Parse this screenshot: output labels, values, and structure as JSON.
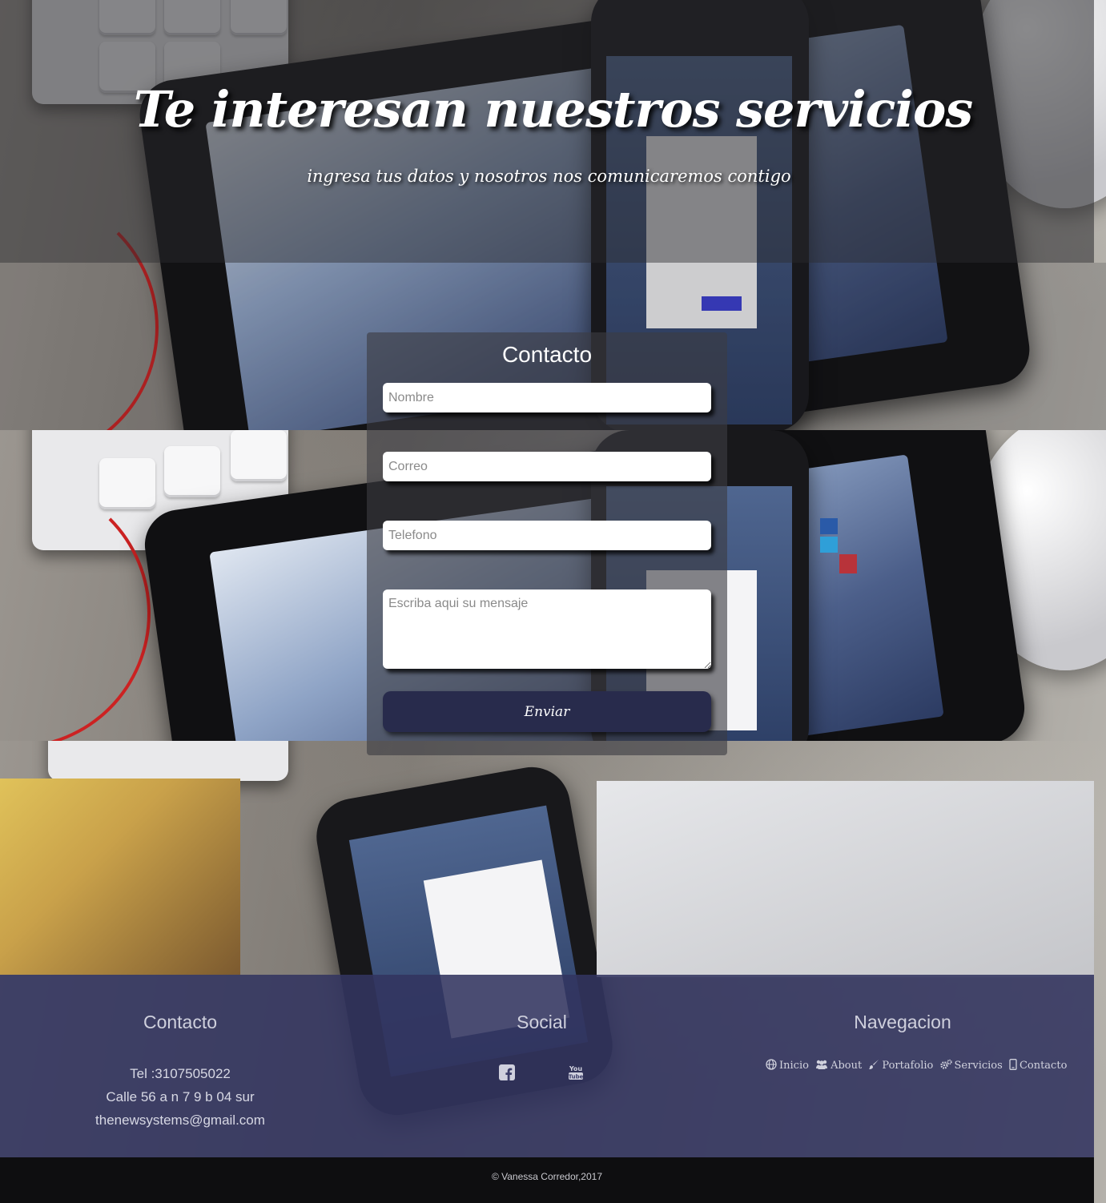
{
  "header": {
    "title": "Te interesan nuestros servicios",
    "subtitle": "ingresa tus datos y nosotros nos comunicaremos contigo"
  },
  "contact_form": {
    "title": "Contacto",
    "name_placeholder": "Nombre",
    "email_placeholder": "Correo",
    "phone_placeholder": "Telefono",
    "message_placeholder": "Escriba aqui su mensaje",
    "submit_label": "Enviar"
  },
  "footer": {
    "contact": {
      "heading": "Contacto",
      "phone": "Tel :3107505022",
      "address": "Calle 56 a n 7 9 b 04 sur",
      "email": "thenewsystems@gmail.com"
    },
    "social": {
      "heading": "Social",
      "icons": [
        "facebook-icon",
        "youtube-icon"
      ]
    },
    "navigation": {
      "heading": "Navegacion",
      "items": [
        {
          "label": "Inicio",
          "icon": "globe-icon"
        },
        {
          "label": "About",
          "icon": "users-icon"
        },
        {
          "label": "Portafolio",
          "icon": "brush-icon"
        },
        {
          "label": "Servicios",
          "icon": "gears-icon"
        },
        {
          "label": "Contacto",
          "icon": "mobile-icon"
        }
      ]
    },
    "copyright": "© Vanessa Corredor,2017"
  },
  "colors": {
    "footer_bg": "#323460",
    "button_bg": "#282b4c",
    "bottom_bar": "#0e0e10"
  }
}
